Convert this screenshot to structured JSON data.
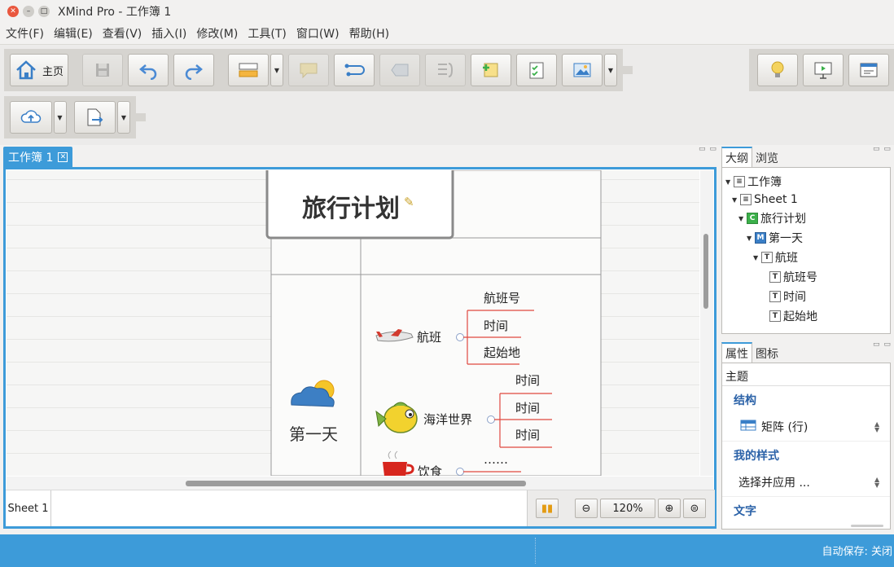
{
  "window": {
    "title": "XMind Pro - 工作簿 1"
  },
  "menu": [
    {
      "label": "文件(F)"
    },
    {
      "label": "编辑(E)"
    },
    {
      "label": "查看(V)"
    },
    {
      "label": "插入(I)"
    },
    {
      "label": "修改(M)"
    },
    {
      "label": "工具(T)"
    },
    {
      "label": "窗口(W)"
    },
    {
      "label": "帮助(H)"
    }
  ],
  "toolbar": {
    "home_label": "主页"
  },
  "editor": {
    "tab_label": "工作簿 1"
  },
  "mindmap": {
    "central_topic": "旅行计划",
    "row_label": "第一天",
    "branches": [
      {
        "label": "航班",
        "items": [
          "航班号",
          "时间",
          "起始地"
        ]
      },
      {
        "label": "海洋世界",
        "items": [
          "时间",
          "时间",
          "时间"
        ]
      },
      {
        "label": "饮食",
        "items": [
          "……"
        ]
      }
    ]
  },
  "status": {
    "sheet_tab": "Sheet 1",
    "zoom": "120%"
  },
  "outline": {
    "tabs": [
      "大纲",
      "浏览"
    ],
    "items": [
      {
        "label": "工作簿"
      },
      {
        "label": "Sheet 1"
      },
      {
        "label": "旅行计划"
      },
      {
        "label": "第一天"
      },
      {
        "label": "航班"
      },
      {
        "label": "航班号"
      },
      {
        "label": "时间"
      },
      {
        "label": "起始地"
      }
    ]
  },
  "properties": {
    "tabs": [
      "属性",
      "图标"
    ],
    "header": "主题",
    "sections": {
      "structure": "结构",
      "structure_value": "矩阵 (行)",
      "my_style": "我的样式",
      "my_style_value": "选择并应用 ...",
      "text": "文字"
    }
  },
  "footer": {
    "autosave": "自动保存: 关闭"
  },
  "colors": {
    "accent": "#3d9bd9",
    "section_title": "#2b62a8",
    "branch_line": "#e0483f"
  }
}
